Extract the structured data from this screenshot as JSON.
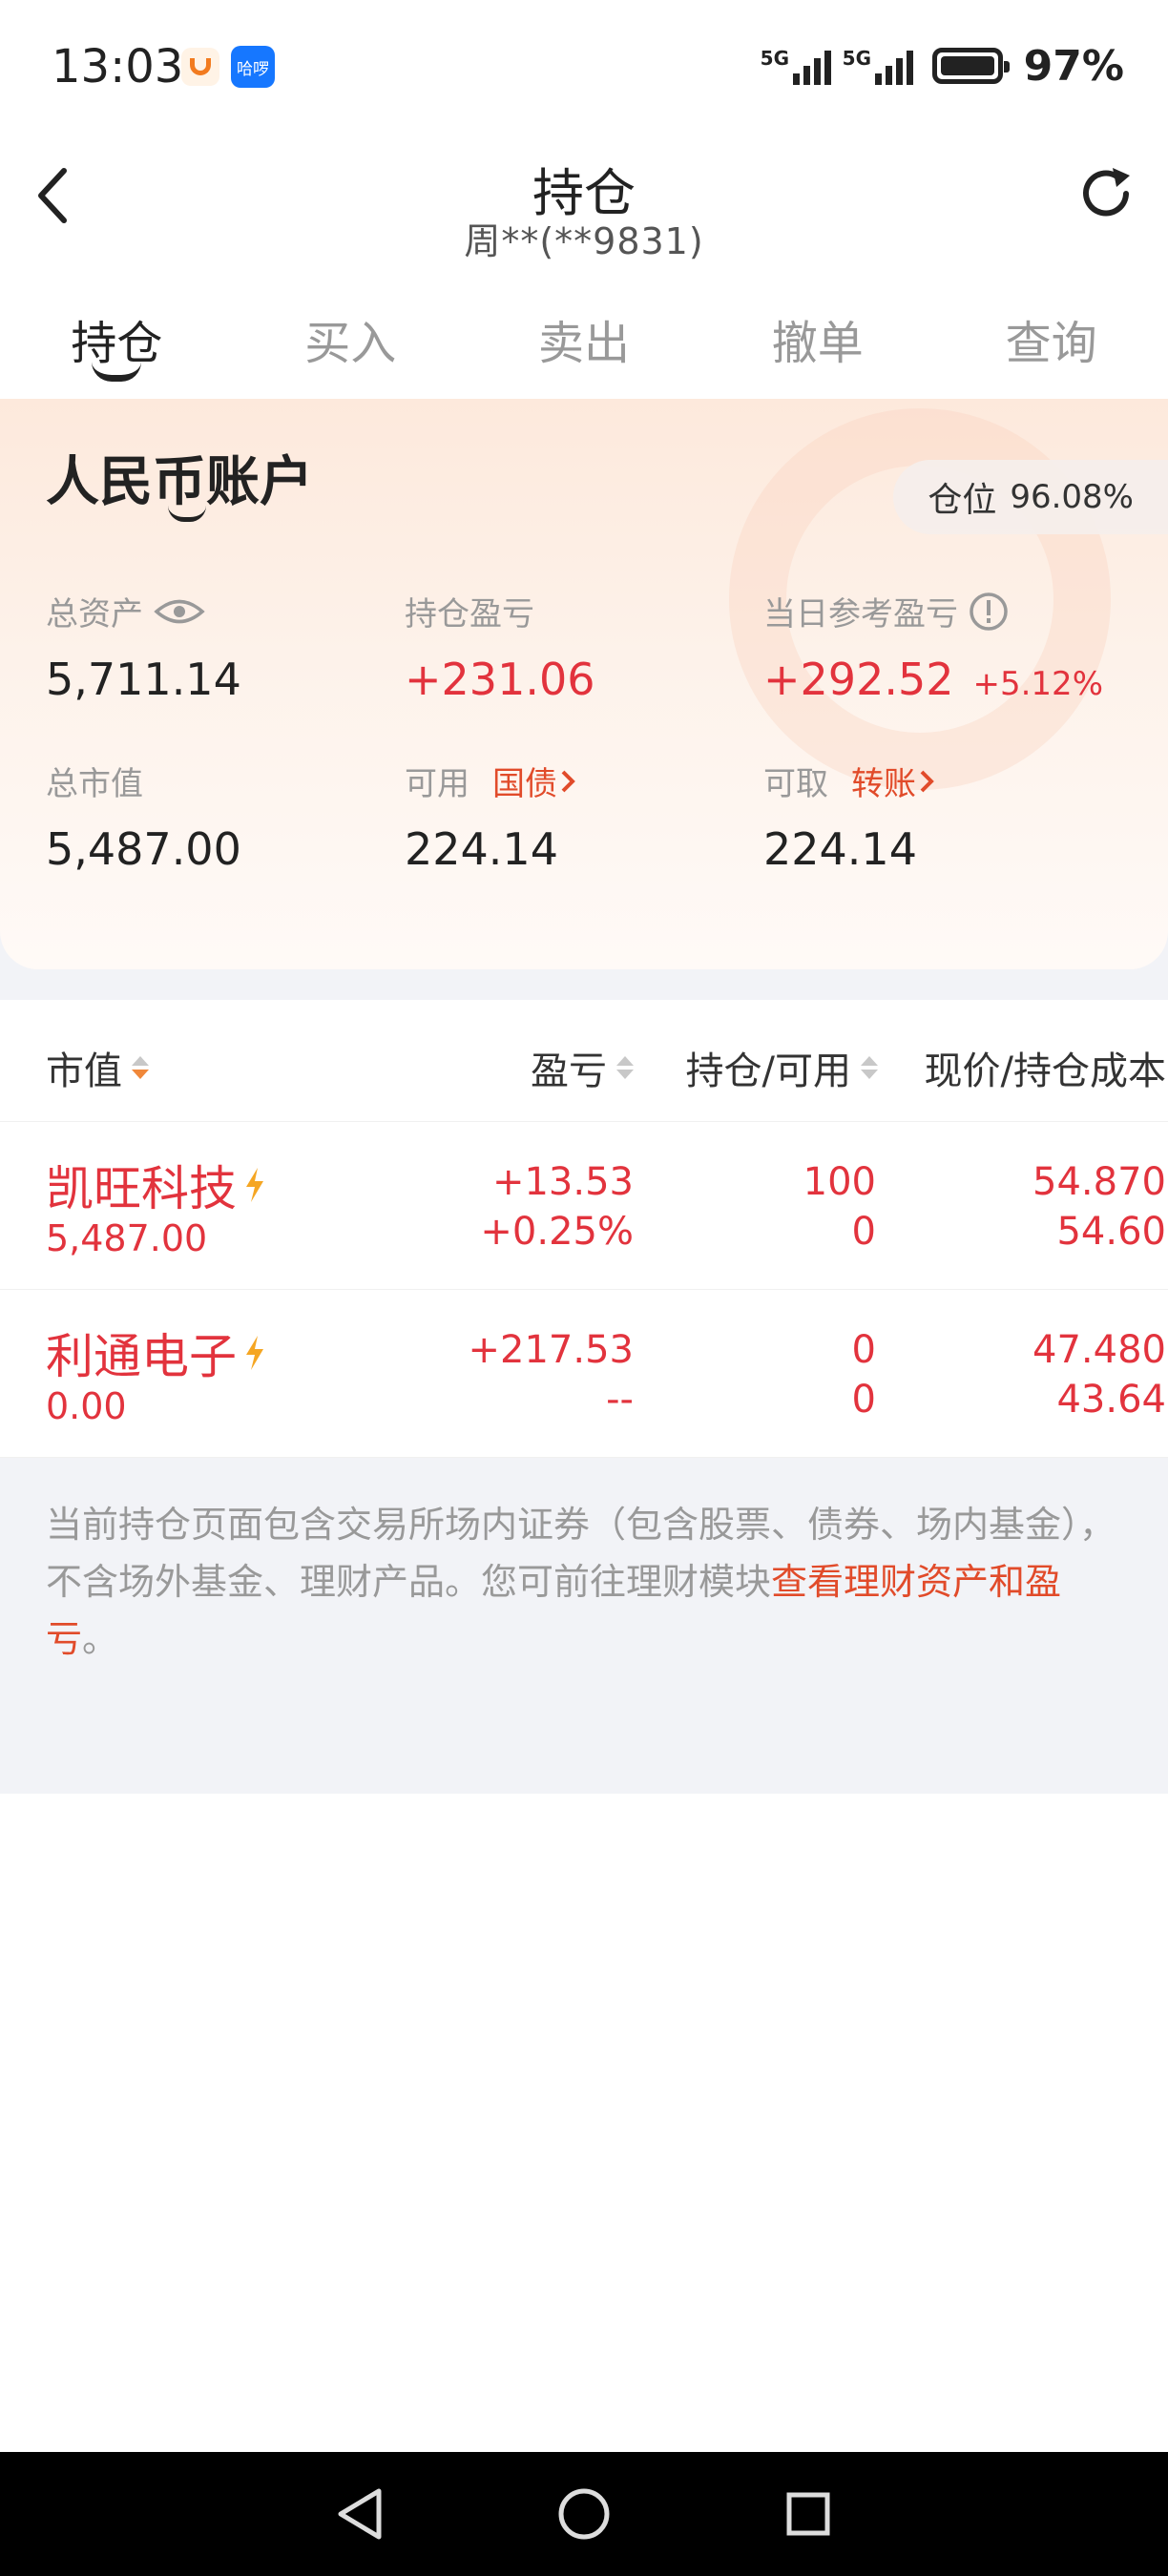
{
  "status_bar": {
    "time": "13:03",
    "app_icon_2_text": "哈啰",
    "signal_1_label": "5G",
    "signal_2_label": "5G",
    "battery_percent": "97%"
  },
  "header": {
    "title": "持仓",
    "account": "周**(**9831)"
  },
  "tabs": [
    {
      "label": "持仓",
      "active": true
    },
    {
      "label": "买入",
      "active": false
    },
    {
      "label": "卖出",
      "active": false
    },
    {
      "label": "撤单",
      "active": false
    },
    {
      "label": "查询",
      "active": false
    }
  ],
  "account": {
    "title": "人民币账户",
    "position_label": "仓位",
    "position_value": "96.08%",
    "total_assets_label": "总资产",
    "total_assets": "5,711.14",
    "holding_pl_label": "持仓盈亏",
    "holding_pl": "+231.06",
    "daily_pl_label": "当日参考盈亏",
    "daily_pl": "+292.52",
    "daily_pl_pct": "+5.12%",
    "market_value_label": "总市值",
    "market_value": "5,487.00",
    "available_label": "可用",
    "available_link": "国债",
    "available": "224.14",
    "withdrawable_label": "可取",
    "withdrawable_link": "转账",
    "withdrawable": "224.14"
  },
  "holdings_header": {
    "market_value": "市值",
    "pl": "盈亏",
    "qty": "持仓/可用",
    "price": "现价/持仓成本"
  },
  "holdings": [
    {
      "name": "凯旺科技",
      "market_value": "5,487.00",
      "pl": "+13.53",
      "pl_pct": "+0.25%",
      "qty": "100",
      "available": "0",
      "price": "54.870",
      "cost": "54.60"
    },
    {
      "name": "利通电子",
      "market_value": "0.00",
      "pl": "+217.53",
      "pl_pct": "--",
      "qty": "0",
      "available": "0",
      "price": "47.480",
      "cost": "43.64"
    }
  ],
  "note": {
    "text": "当前持仓页面包含交易所场内证券（包含股票、债券、场内基金），不含场外基金、理财产品。您可前往理财模块",
    "link": "查看理财资产和盈亏",
    "end": "。"
  },
  "colors": {
    "up_red": "#e2333d",
    "link_orange": "#e14b2a",
    "sort_active": "#f0883a"
  }
}
